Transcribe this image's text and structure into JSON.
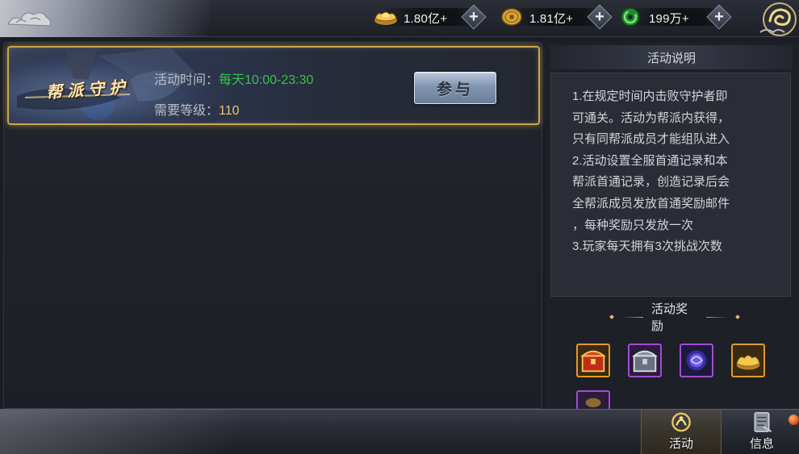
{
  "currencies": [
    {
      "name": "gold-ingot",
      "value": "1.80亿+"
    },
    {
      "name": "gold-coin",
      "value": "1.81亿+"
    },
    {
      "name": "green-jade",
      "value": "199万+"
    }
  ],
  "activity": {
    "title": "帮派守护",
    "time_label": "活动时间：",
    "time_value": "每天10:00-23:30",
    "level_label": "需要等级：",
    "level_value": "110",
    "join_label": "参与"
  },
  "description": {
    "header": "活动说明",
    "lines": [
      "1.在规定时间内击败守护者即",
      "可通关。活动为帮派内获得，",
      "只有同帮派成员才能组队进入",
      "2.活动设置全服首通记录和本",
      "帮派首通记录，创造记录后会",
      "全帮派成员发放首通奖励邮件",
      "，每种奖励只发放一次",
      "3.玩家每天拥有3次挑战次数"
    ]
  },
  "rewards": {
    "title": "活动奖励",
    "items": [
      {
        "icon": "gold-treasure-chest-icon",
        "quality_color": "#e09a2a"
      },
      {
        "icon": "silver-treasure-chest-icon",
        "quality_color": "#a24bd6"
      },
      {
        "icon": "purple-orb-icon",
        "quality_color": "#a24bd6"
      },
      {
        "icon": "gold-ingot-icon",
        "quality_color": "#e09a2a"
      },
      {
        "icon": "purple-item-icon",
        "quality_color": "#a24bd6"
      }
    ]
  },
  "bottom_tabs": [
    {
      "label": "活动",
      "icon": "activity-icon",
      "active": true
    },
    {
      "label": "信息",
      "icon": "scroll-icon",
      "active": false
    }
  ],
  "colors": {
    "highlight_green": "#36c24a",
    "level_gold": "#e7c767",
    "card_border_gold": "#c9a64a",
    "notification": "#e2561b"
  }
}
